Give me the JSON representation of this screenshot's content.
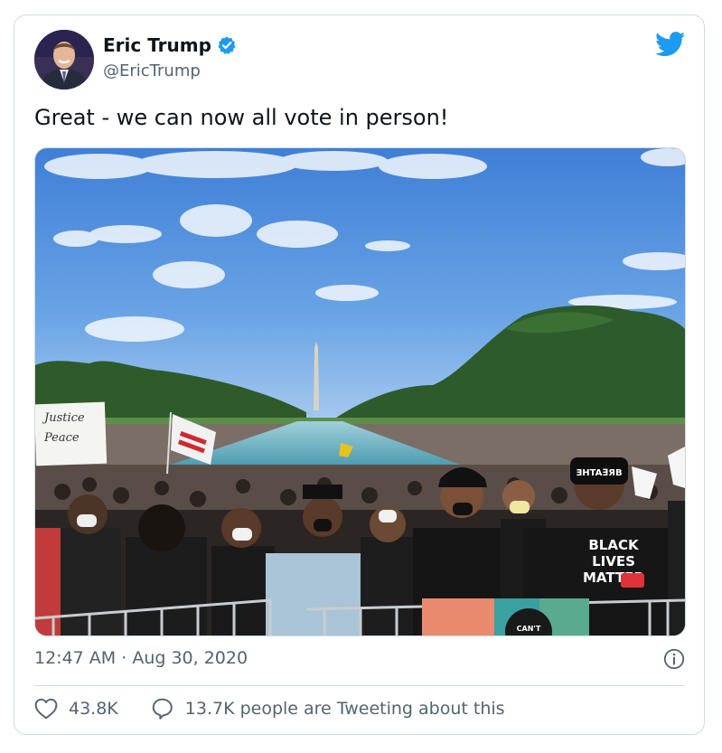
{
  "author": {
    "name": "Eric Trump",
    "handle": "@EricTrump",
    "verified": true
  },
  "tweet": {
    "text": "Great - we can now all vote in person!",
    "time": "12:47 AM",
    "separator": "·",
    "date": "Aug 30, 2020"
  },
  "stats": {
    "likes": "43.8K",
    "conversation": "13.7K people are Tweeting about this"
  },
  "photo": {
    "sign_line1": "Justice",
    "sign_line2": "Peace",
    "shirt_line1": "BLACK",
    "shirt_line2": "LIVES",
    "shirt_line3": "MATTER",
    "hat_text": "CAN'T"
  },
  "icons": {
    "brand": "twitter-bird-icon",
    "verified": "verified-badge-icon",
    "info": "info-icon",
    "like": "heart-icon",
    "reply": "speech-bubble-icon"
  },
  "colors": {
    "brand_blue": "#1d9bf0",
    "text_primary": "#0f1419",
    "text_secondary": "#536471",
    "border": "#cfd9de"
  }
}
